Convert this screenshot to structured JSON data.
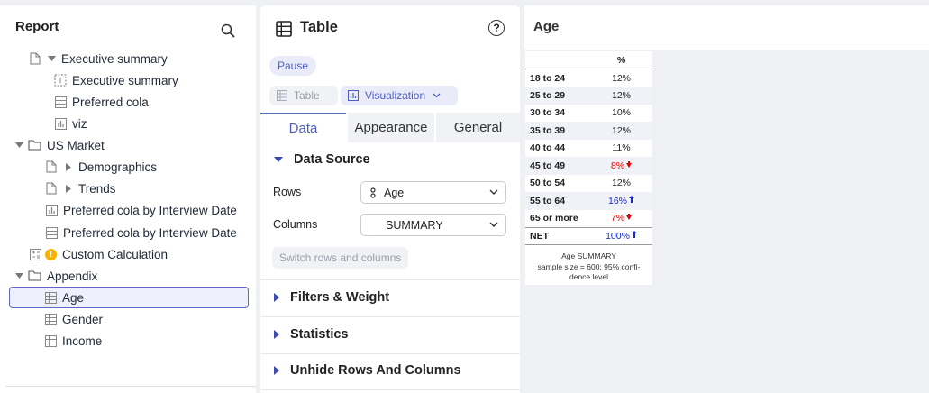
{
  "report": {
    "title": "Report",
    "items": [
      {
        "label": "Executive summary",
        "icon": "page-icon",
        "toggle": "expanded"
      },
      {
        "label": "Executive summary",
        "icon": "text-box-icon"
      },
      {
        "label": "Preferred cola",
        "icon": "table-icon"
      },
      {
        "label": "viz",
        "icon": "chart-icon"
      },
      {
        "label": "US Market",
        "icon": "folder-icon",
        "toggle": "expanded"
      },
      {
        "label": "Demographics",
        "icon": "page-icon",
        "toggle": "collapsed"
      },
      {
        "label": "Trends",
        "icon": "page-icon",
        "toggle": "collapsed"
      },
      {
        "label": "Preferred cola by Interview Date",
        "icon": "chart-icon"
      },
      {
        "label": "Preferred cola by Interview Date",
        "icon": "table-icon"
      },
      {
        "label": "Custom Calculation",
        "icon": "calculator-icon",
        "badge": "!"
      },
      {
        "label": "Appendix",
        "icon": "folder-icon",
        "toggle": "expanded"
      },
      {
        "label": "Age",
        "icon": "table-icon",
        "selected": true
      },
      {
        "label": "Gender",
        "icon": "table-icon"
      },
      {
        "label": "Income",
        "icon": "table-icon"
      }
    ]
  },
  "editor": {
    "title": "Table",
    "help": "?",
    "pause_label": "Pause",
    "view_table_label": "Table",
    "view_viz_label": "Visualization",
    "tabs": [
      "Data",
      "Appearance",
      "General"
    ],
    "data_source_label": "Data Source",
    "rows_label": "Rows",
    "rows_value": "Age",
    "columns_label": "Columns",
    "columns_value": "SUMMARY",
    "switch_label": "Switch rows and columns",
    "filters_label": "Filters & Weight",
    "statistics_label": "Statistics",
    "unhide_label": "Unhide Rows And Columns"
  },
  "output": {
    "title": "Age",
    "column_header": "%",
    "rows": [
      {
        "label": "18 to 24",
        "value": "12%"
      },
      {
        "label": "25 to 29",
        "value": "12%"
      },
      {
        "label": "30 to 34",
        "value": "10%"
      },
      {
        "label": "35 to 39",
        "value": "12%"
      },
      {
        "label": "40 to 44",
        "value": "11%"
      },
      {
        "label": "45 to 49",
        "value": "8%",
        "flag": "down"
      },
      {
        "label": "50 to 54",
        "value": "12%"
      },
      {
        "label": "55 to 64",
        "value": "16%",
        "flag": "up"
      },
      {
        "label": "65 or more",
        "value": "7%",
        "flag": "down"
      },
      {
        "label": "NET",
        "value": "100%",
        "flag": "up"
      }
    ],
    "note_line1": "Age SUMMARY",
    "note_line2": "sample size = 600; 95% confi-",
    "note_line3": "dence level"
  },
  "colors": {
    "accent": "#5c6bc0",
    "sig_down": "#e00000",
    "sig_up": "#1428c8",
    "warning": "#f4b400"
  }
}
